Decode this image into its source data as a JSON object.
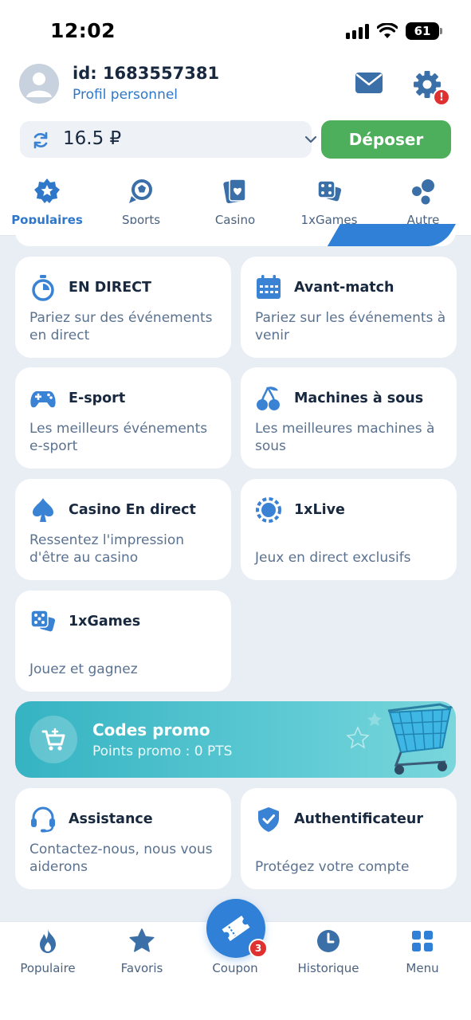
{
  "status_bar": {
    "time": "12:02",
    "battery": "61"
  },
  "profile": {
    "id": "id: 1683557381",
    "subtitle": "Profil personnel"
  },
  "balance": {
    "amount": "16.5 ₽"
  },
  "deposit": {
    "label": "Déposer"
  },
  "categories": [
    {
      "label": "Populaires",
      "icon": "star-badge-icon",
      "active": true
    },
    {
      "label": "Sports",
      "icon": "sports-ball-icon",
      "active": false
    },
    {
      "label": "Casino",
      "icon": "cards-icon",
      "active": false
    },
    {
      "label": "1xGames",
      "icon": "dice-icon",
      "active": false
    },
    {
      "label": "Autre",
      "icon": "bubbles-icon",
      "active": false
    }
  ],
  "cards": [
    {
      "title": "EN DIRECT",
      "desc": "Pariez sur des événements en direct",
      "icon": "stopwatch-icon"
    },
    {
      "title": "Avant-match",
      "desc": "Pariez sur les événements à venir",
      "icon": "calendar-icon"
    },
    {
      "title": "E-sport",
      "desc": "Les meilleurs événements e-sport",
      "icon": "gamepad-icon"
    },
    {
      "title": "Machines à sous",
      "desc": "Les meilleures machines à sous",
      "icon": "cherries-icon"
    },
    {
      "title": "Casino En direct",
      "desc": "Ressentez l'impression d'être au casino",
      "icon": "spade-icon"
    },
    {
      "title": "1xLive",
      "desc": "Jeux en direct exclusifs",
      "icon": "live-chip-icon"
    },
    {
      "title": "1xGames",
      "desc": "Jouez et gagnez",
      "icon": "dice-icon"
    }
  ],
  "promo": {
    "title": "Codes promo",
    "subtitle": "Points promo : 0 PTS"
  },
  "support_cards": [
    {
      "title": "Assistance",
      "desc": "Contactez-nous, nous vous aiderons",
      "icon": "headset-icon"
    },
    {
      "title": "Authentificateur",
      "desc": "Protégez votre compte",
      "icon": "shield-check-icon"
    }
  ],
  "bottom_nav": {
    "items": [
      {
        "label": "Populaire",
        "icon": "flame-icon"
      },
      {
        "label": "Favoris",
        "icon": "star-icon"
      },
      {
        "label": "Historique",
        "icon": "clock-icon"
      },
      {
        "label": "Menu",
        "icon": "grid-icon"
      }
    ],
    "coupon": {
      "label": "Coupon",
      "count": "3",
      "icon": "ticket-icon"
    }
  },
  "colors": {
    "accent": "#2f77c9",
    "deposit": "#4dae5b",
    "promo": "#35b3c2",
    "alert": "#e03131",
    "icon": "#3a83d4"
  }
}
